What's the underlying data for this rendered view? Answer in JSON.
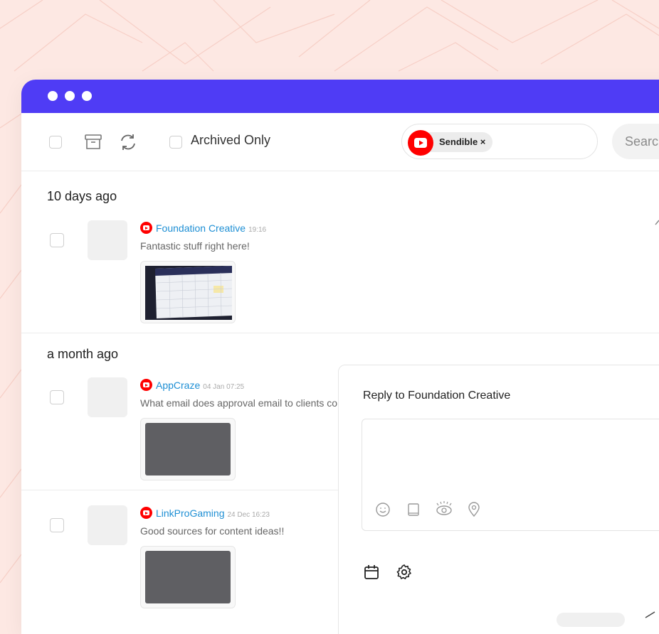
{
  "toolbar": {
    "archived_label": "Archived Only",
    "filter_chip_label": "Sendible ×",
    "search_placeholder": "Search"
  },
  "groups": [
    {
      "heading": "10 days ago",
      "items": [
        {
          "author": "Foundation Creative",
          "time": "19:16",
          "message": "Fantastic stuff right here!"
        }
      ]
    },
    {
      "heading": "a month ago",
      "items": [
        {
          "author": "AppCraze",
          "time": "04 Jan 07:25",
          "message": "What email does approval email to clients co"
        },
        {
          "author": "LinkProGaming",
          "time": "24 Dec 16:23",
          "message": "Good sources for content ideas!!"
        }
      ]
    }
  ],
  "reply": {
    "title": "Reply to Foundation Creative"
  },
  "colors": {
    "titlebar": "#4f3cf5",
    "background": "#fde8e3",
    "link": "#1e8fd4",
    "youtube": "#ff0000"
  },
  "icons": [
    "select-all-checkbox",
    "archive-icon",
    "refresh-icon",
    "youtube-icon",
    "emoji-icon",
    "book-icon",
    "eye-icon",
    "location-icon",
    "calendar-icon",
    "gear-icon"
  ]
}
